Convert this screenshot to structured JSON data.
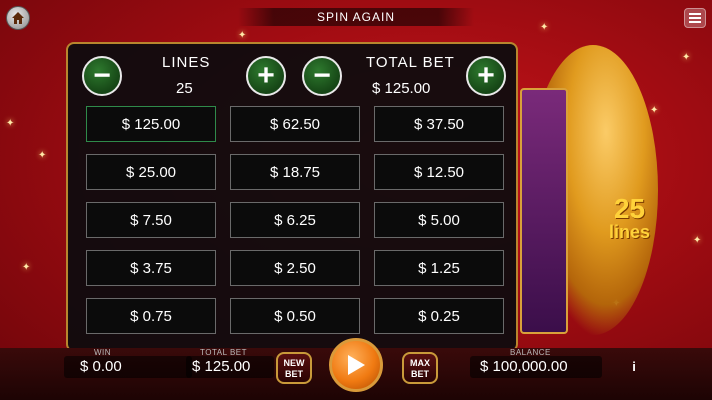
{
  "banner": {
    "text": "SPIN AGAIN"
  },
  "background": {
    "lines_number": "25",
    "lines_word": "lines"
  },
  "panel": {
    "lines_header": "LINES",
    "lines_value": "25",
    "total_bet_header": "TOTAL BET",
    "total_bet_value": "$ 125.00",
    "minus_glyph": "−",
    "plus_glyph": "+",
    "bet_options": [
      [
        "$ 125.00",
        "$ 62.50",
        "$ 37.50"
      ],
      [
        "$ 25.00",
        "$ 18.75",
        "$ 12.50"
      ],
      [
        "$ 7.50",
        "$ 6.25",
        "$ 5.00"
      ],
      [
        "$ 3.75",
        "$ 2.50",
        "$ 1.25"
      ],
      [
        "$ 0.75",
        "$ 0.50",
        "$ 0.25"
      ]
    ],
    "selected_option": "$ 125.00"
  },
  "bottom": {
    "win_label": "WIN",
    "win_value": "$  0.00",
    "total_bet_label": "TOTAL BET",
    "total_bet_value": "$ 125.00",
    "new_bet_top": "NEW",
    "new_bet_bottom": "BET",
    "max_bet_top": "MAX",
    "max_bet_bottom": "BET",
    "balance_label": "BALANCE",
    "balance_value": "$ 100,000.00",
    "info_glyph": "i"
  },
  "colors": {
    "accent_green": "#2f8a4a",
    "panel_border": "#b8862e",
    "background_red": "#c8141a",
    "spin_orange": "#f07a12"
  },
  "icons": [
    "home-icon",
    "menu-icon",
    "minus-icon",
    "plus-icon",
    "play-icon",
    "info-icon"
  ]
}
